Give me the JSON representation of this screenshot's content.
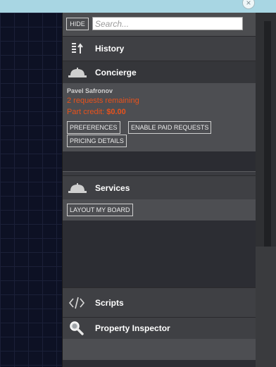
{
  "window": {
    "close_icon": "close-icon",
    "close_glyph": "×"
  },
  "search": {
    "hide_label": "HIDE",
    "placeholder": "Search...",
    "value": ""
  },
  "sections": {
    "history": {
      "title": "History",
      "icon": "history-icon"
    },
    "concierge": {
      "title": "Concierge",
      "icon": "concierge-bell-icon",
      "user_name": "Pavel Safronov",
      "requests_text": "2 requests remaining",
      "credit_label": "Part credit:",
      "credit_value": "$0.00",
      "buttons": [
        "PREFERENCES",
        "ENABLE PAID REQUESTS",
        "PRICING DETAILS"
      ]
    },
    "services": {
      "title": "Services",
      "icon": "service-bell-icon",
      "buttons": [
        "LAYOUT MY BOARD"
      ]
    },
    "scripts": {
      "title": "Scripts",
      "icon": "code-icon"
    },
    "inspector": {
      "title": "Property Inspector",
      "icon": "magnifier-icon"
    }
  },
  "colors": {
    "accent_orange": "#e8521c",
    "topbar": "#a8d6e3",
    "panel": "#2b2c32"
  }
}
